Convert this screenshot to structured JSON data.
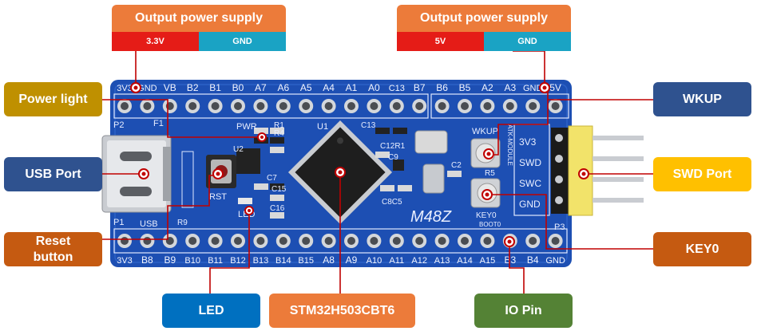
{
  "supply_left": {
    "title": "Output power supply",
    "left_cell": "3.3V",
    "right_cell": "GND"
  },
  "supply_right": {
    "title": "Output power supply",
    "left_cell": "5V",
    "right_cell": "GND"
  },
  "callouts": {
    "power_light": "Power light",
    "usb_port": "USB Port",
    "reset_button": "Reset button",
    "led": "LED",
    "mcu": "STM32H503CBT6",
    "io_pin": "IO Pin",
    "wkup": "WKUP",
    "swd_port": "SWD Port",
    "key0": "KEY0"
  },
  "board": {
    "top_pins": [
      "3V3",
      "GND",
      "VB",
      "B2",
      "B1",
      "B0",
      "A7",
      "A6",
      "A5",
      "A4",
      "A1",
      "A0",
      "C13",
      "B7",
      "B6",
      "B5",
      "A2",
      "A3",
      "GND",
      "5V"
    ],
    "bottom_pins": [
      "3V3",
      "B8",
      "B9",
      "B10",
      "B11",
      "B12",
      "B13",
      "B14",
      "B15",
      "A8",
      "A9",
      "A10",
      "A11",
      "A12",
      "A13",
      "A14",
      "A15",
      "B3",
      "B4",
      "GND"
    ],
    "model": "M48Z",
    "module_text": "ATK-MODULE",
    "swd_labels": [
      "3V3",
      "SWD",
      "SWC",
      "GND"
    ],
    "silk": {
      "p1": "P1",
      "p2": "P2",
      "p3": "P3",
      "usb": "USB",
      "rst": "RST",
      "pwr": "PWR",
      "led": "LED",
      "u1": "U1",
      "u2": "U2",
      "f1": "F1",
      "wkup": "WKUP",
      "key0": "KEY0",
      "boot0": "BOOT0",
      "r1": "R1",
      "r4": "R4",
      "r5": "R5",
      "r9": "R9",
      "c2": "C2",
      "c7": "C7",
      "c9": "C9",
      "c13": "C13",
      "c15": "C15",
      "c16": "C16",
      "c8c5": "C8C5",
      "c12r1": "C12R1"
    }
  },
  "colors": {
    "board": "#1d4fb3",
    "orange": "#ec7b3a",
    "red": "#e51c17",
    "teal": "#1aa3c4",
    "gold": "#bf9000",
    "navy": "#2f528f",
    "rust": "#c55a11",
    "blue": "#0070c0",
    "green": "#548235",
    "yellow": "#ffc000",
    "pointer": "#c00000"
  }
}
